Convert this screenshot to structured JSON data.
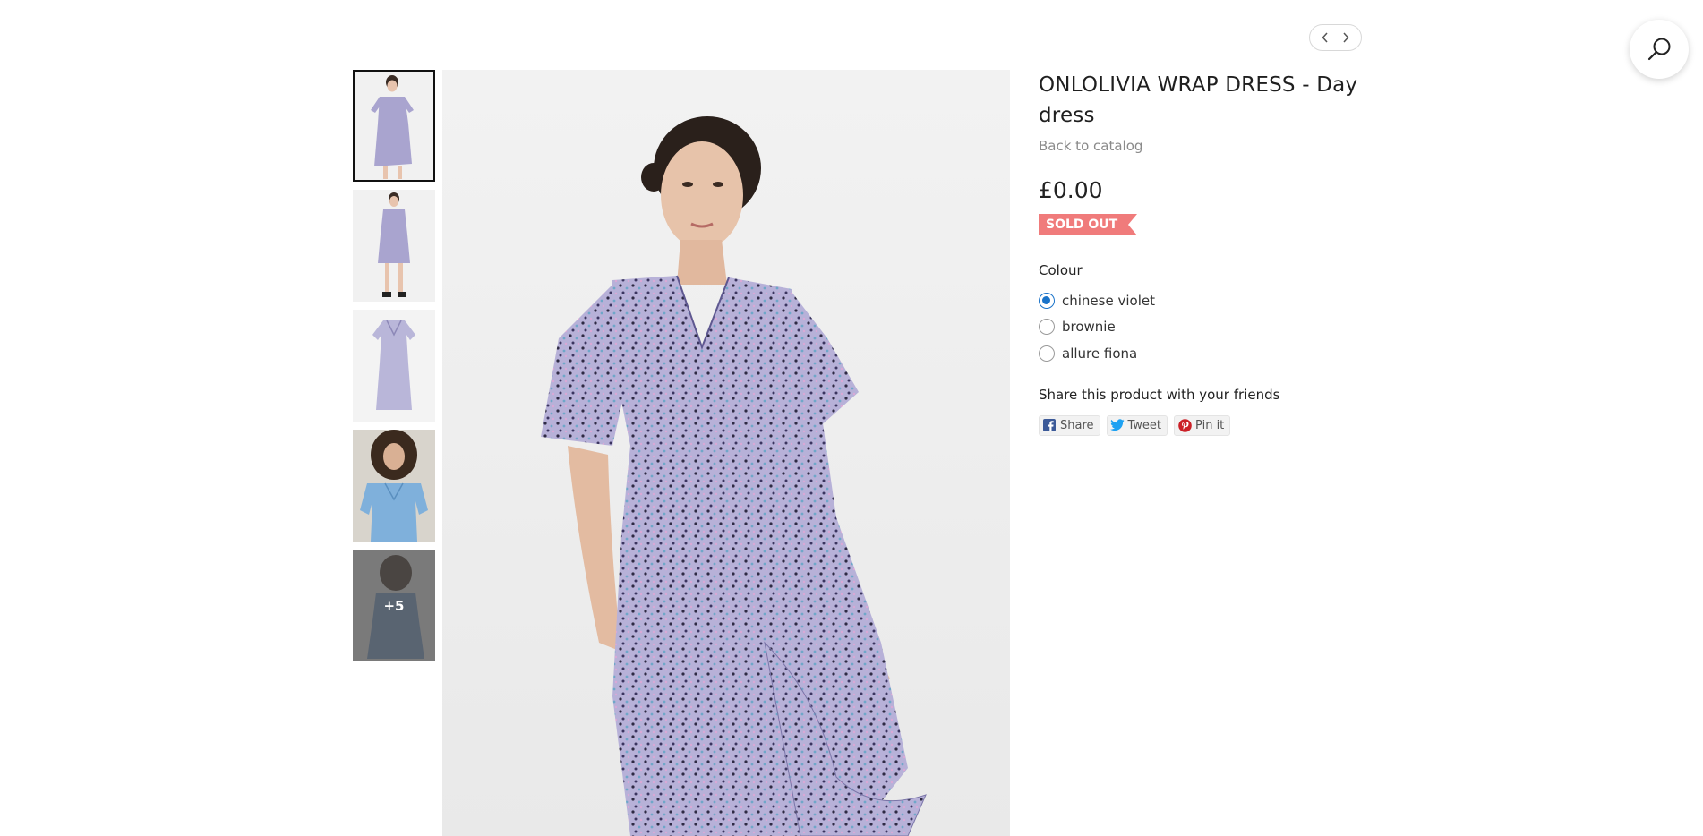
{
  "product": {
    "title": "ONLOLIVIA WRAP DRESS - Day dress",
    "back_link": "Back to catalog",
    "price": "£0.00",
    "status_badge": "SOLD OUT",
    "badge_color": "#f07b7b"
  },
  "colour": {
    "label": "Colour",
    "options": [
      {
        "label": "chinese violet",
        "selected": true
      },
      {
        "label": "brownie",
        "selected": false
      },
      {
        "label": "allure fiona",
        "selected": false
      }
    ]
  },
  "share": {
    "label": "Share this product with your friends",
    "buttons": [
      {
        "label": "Share",
        "icon": "facebook-icon",
        "color": "#3b5998"
      },
      {
        "label": "Tweet",
        "icon": "twitter-icon",
        "color": "#1da1f2"
      },
      {
        "label": "Pin it",
        "icon": "pinterest-icon",
        "color": "#cb2027"
      }
    ]
  },
  "gallery": {
    "more_count_label": "+5"
  },
  "nav": {
    "prev_icon": "chevron-left-icon",
    "next_icon": "chevron-right-icon",
    "search_icon": "search-icon"
  },
  "accent_color": "#1a73c9"
}
